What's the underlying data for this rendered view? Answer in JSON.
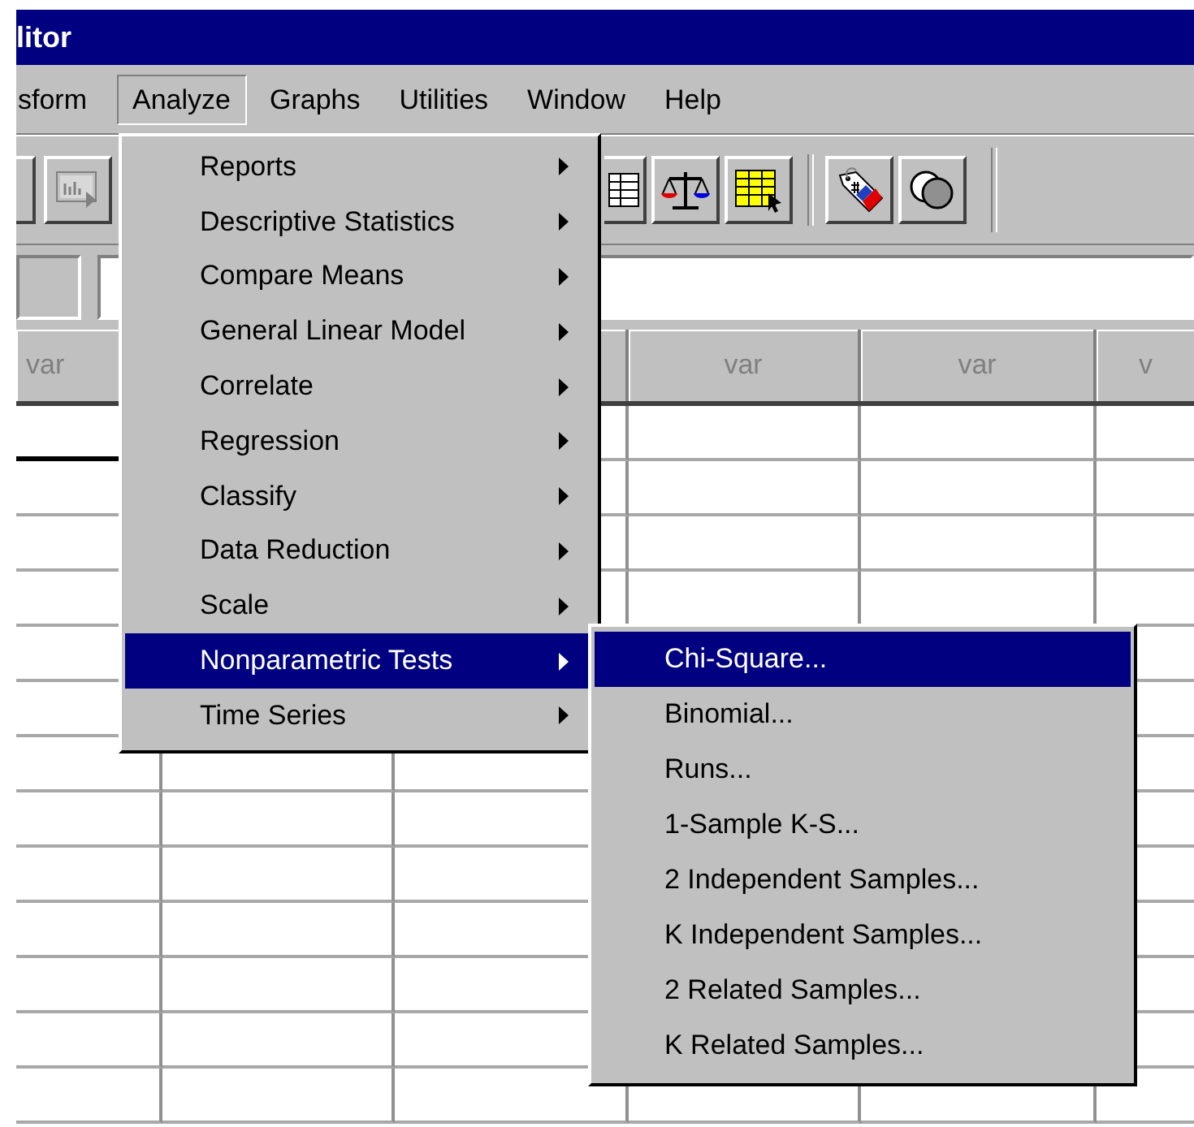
{
  "window": {
    "title": "litor"
  },
  "menu_bar": [
    {
      "label": "sform",
      "selected": false
    },
    {
      "label": "Analyze",
      "selected": true
    },
    {
      "label": "Graphs",
      "selected": false
    },
    {
      "label": "Utilities",
      "selected": false
    },
    {
      "label": "Window",
      "selected": false
    },
    {
      "label": "Help",
      "selected": false
    }
  ],
  "grid": {
    "columns": [
      "var",
      "",
      "",
      "var",
      "var",
      "v"
    ]
  },
  "analyze_menu": [
    {
      "label": "Reports",
      "selected": false
    },
    {
      "label": "Descriptive Statistics",
      "selected": false
    },
    {
      "label": "Compare Means",
      "selected": false
    },
    {
      "label": "General Linear Model",
      "selected": false
    },
    {
      "label": "Correlate",
      "selected": false
    },
    {
      "label": "Regression",
      "selected": false
    },
    {
      "label": "Classify",
      "selected": false
    },
    {
      "label": "Data Reduction",
      "selected": false
    },
    {
      "label": "Scale",
      "selected": false
    },
    {
      "label": "Nonparametric Tests",
      "selected": true
    },
    {
      "label": "Time Series",
      "selected": false
    }
  ],
  "nonparametric_submenu": [
    {
      "label": "Chi-Square...",
      "selected": true
    },
    {
      "label": "Binomial...",
      "selected": false
    },
    {
      "label": "Runs...",
      "selected": false
    },
    {
      "label": "1-Sample K-S...",
      "selected": false
    },
    {
      "label": "2 Independent Samples...",
      "selected": false
    },
    {
      "label": "K Independent Samples...",
      "selected": false
    },
    {
      "label": "2 Related Samples...",
      "selected": false
    },
    {
      "label": "K Related Samples...",
      "selected": false
    }
  ]
}
